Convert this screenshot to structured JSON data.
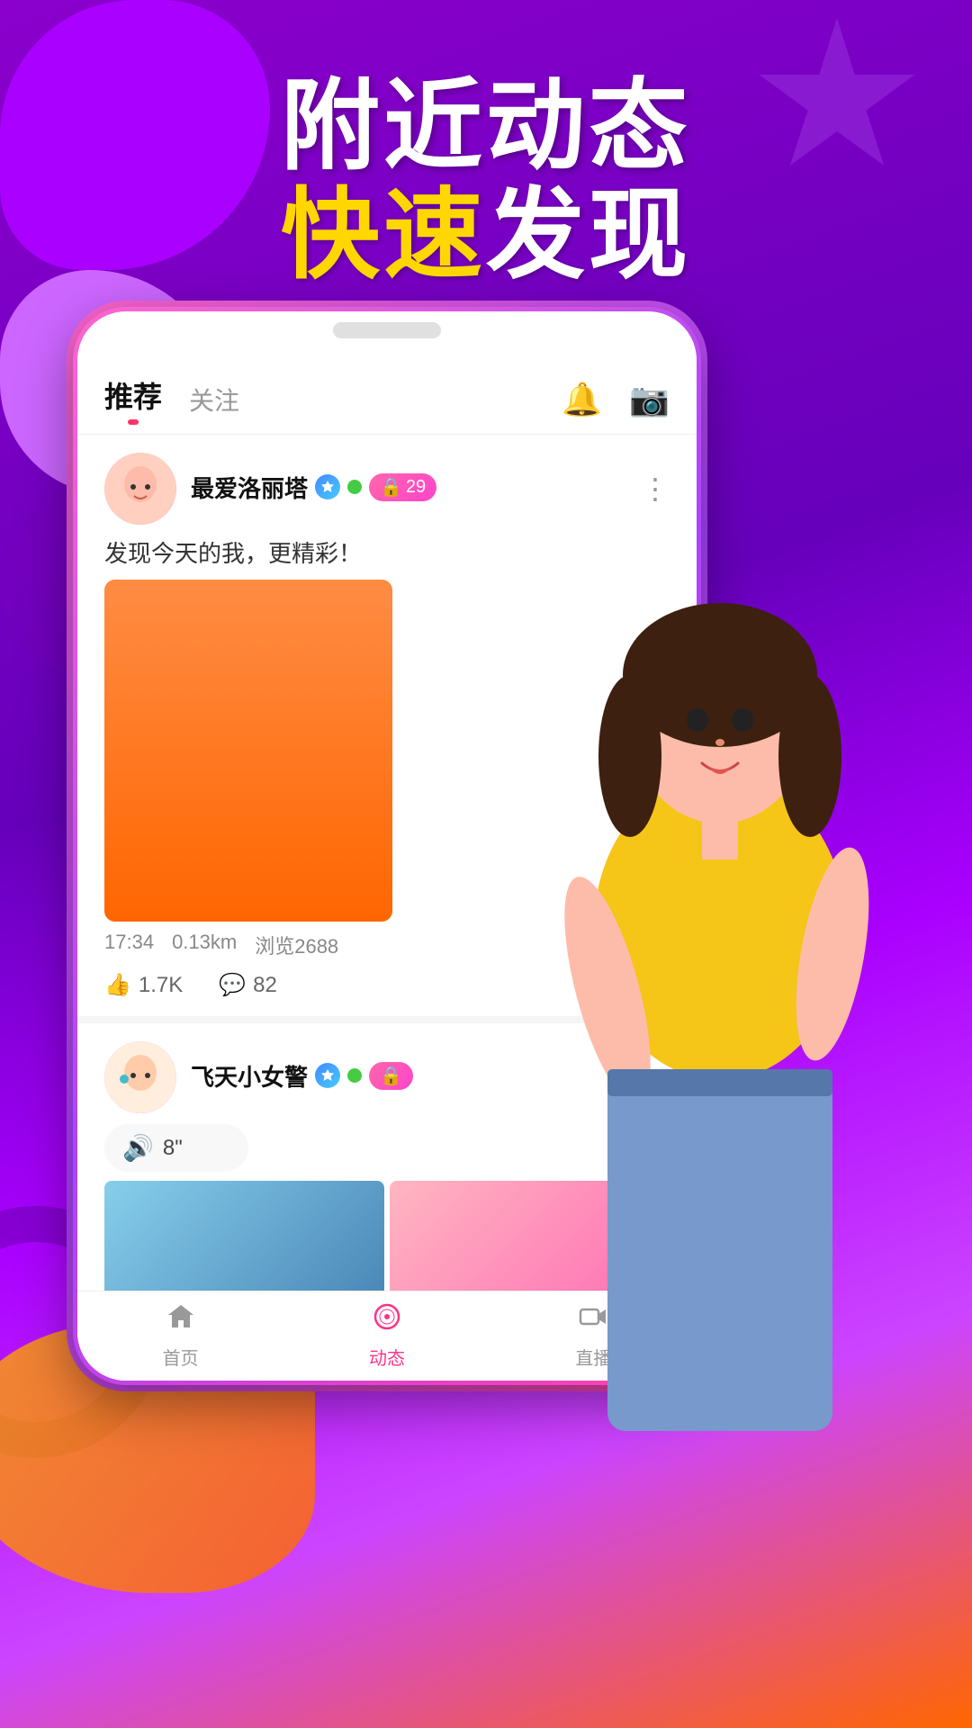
{
  "background": {
    "gradient_start": "#8800CC",
    "gradient_end": "#FF6600"
  },
  "header": {
    "line1": "附近动态",
    "line2_highlight": "快速",
    "line2_rest": "发现"
  },
  "app": {
    "tabs": [
      {
        "label": "推荐",
        "active": true
      },
      {
        "label": "关注",
        "active": false
      }
    ],
    "icons": {
      "bell": "🔔",
      "camera": "📷"
    }
  },
  "posts": [
    {
      "username": "最爱洛丽塔",
      "follower_count": "29",
      "post_text": "发现今天的我，更精彩！",
      "time": "17:34",
      "distance": "0.13km",
      "views": "浏览2688",
      "likes": "1.7K",
      "comments": "82",
      "has_video": true
    },
    {
      "username": "飞天小女警",
      "voice_duration": "8\"",
      "has_photos": true
    }
  ],
  "bottom_nav": [
    {
      "label": "首页",
      "active": false,
      "icon": "home"
    },
    {
      "label": "动态",
      "active": true,
      "icon": "compass"
    },
    {
      "label": "直播",
      "active": false,
      "icon": "video"
    }
  ]
}
